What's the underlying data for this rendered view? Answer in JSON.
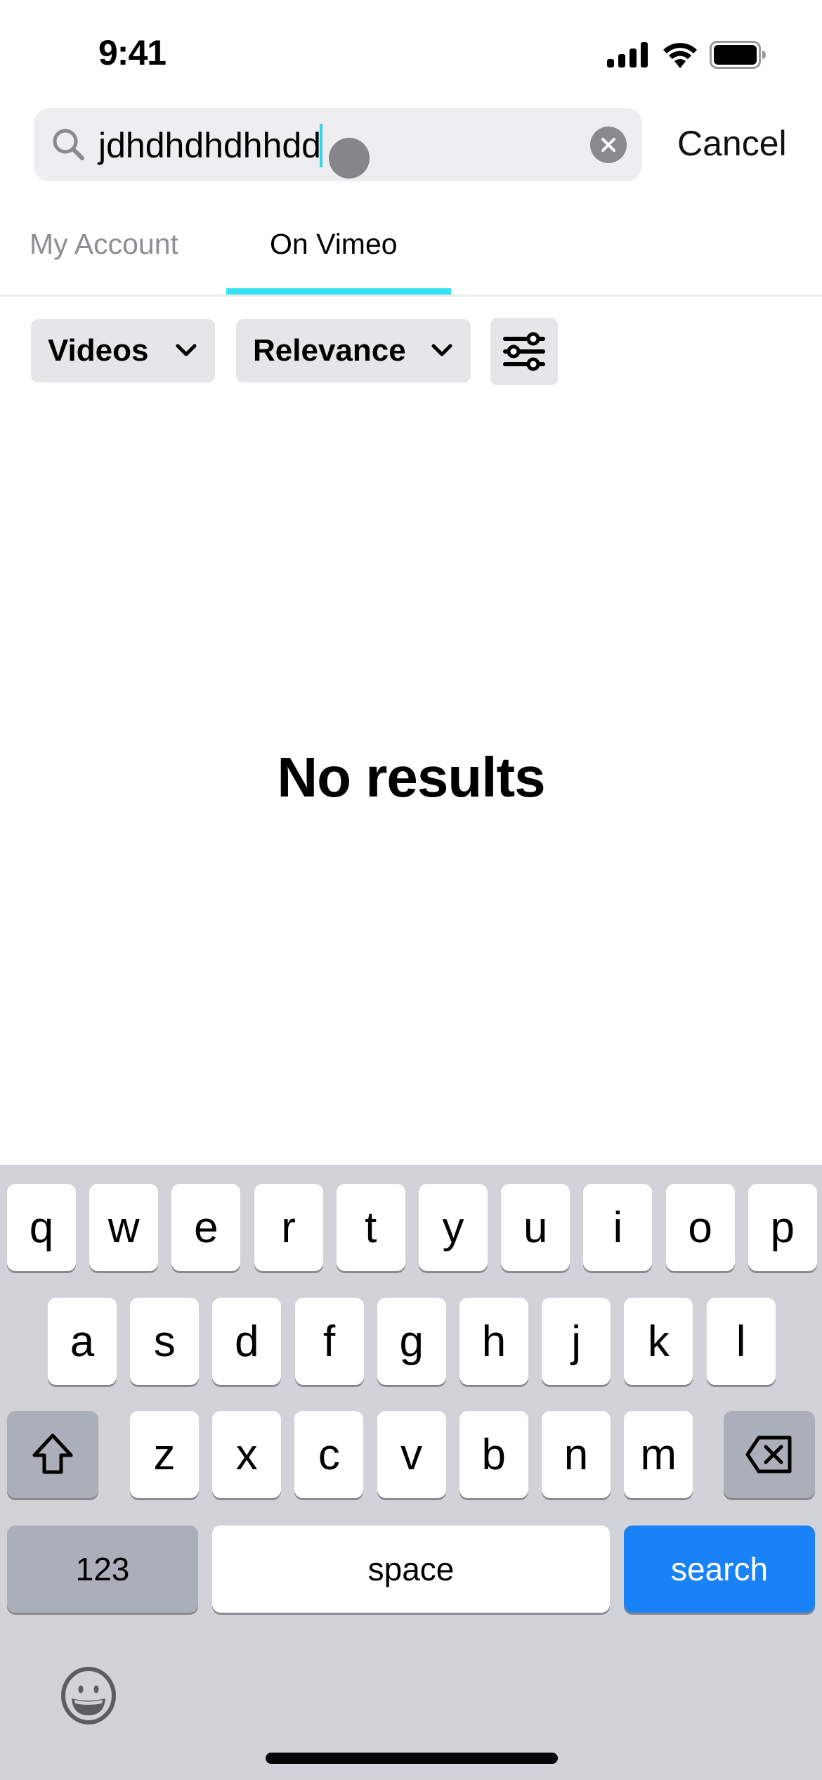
{
  "status_bar": {
    "time": "9:41",
    "icons": [
      "cellular-signal-icon",
      "wifi-icon",
      "battery-icon"
    ]
  },
  "search": {
    "value": "jdhdhdhdhhdd",
    "icon": "search-icon",
    "clear_icon": "clear-icon",
    "cancel_label": "Cancel",
    "caret_color": "#36d4ec"
  },
  "tabs": [
    {
      "label": "My Account",
      "active": false
    },
    {
      "label": "On Vimeo",
      "active": true
    }
  ],
  "tab_indicator_color": "#37e3f2",
  "filters": {
    "type_label": "Videos",
    "sort_label": "Relevance",
    "settings_icon": "sliders-icon"
  },
  "empty_state": {
    "title": "No results"
  },
  "keyboard": {
    "row1": [
      "q",
      "w",
      "e",
      "r",
      "t",
      "y",
      "u",
      "i",
      "o",
      "p"
    ],
    "row2": [
      "a",
      "s",
      "d",
      "f",
      "g",
      "h",
      "j",
      "k",
      "l"
    ],
    "row3": [
      "z",
      "x",
      "c",
      "v",
      "b",
      "n",
      "m"
    ],
    "shift_icon": "shift-icon",
    "delete_icon": "delete-icon",
    "numbers_label": "123",
    "space_label": "space",
    "action_label": "search",
    "emoji_icon": "emoji-icon",
    "action_color": "#1a82f7"
  }
}
